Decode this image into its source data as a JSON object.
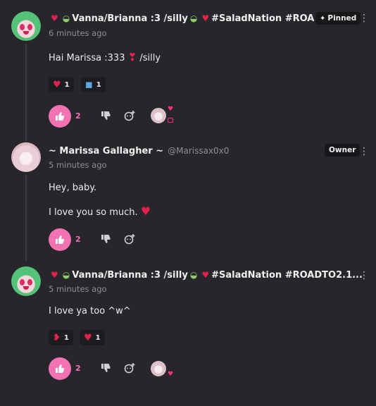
{
  "comments": [
    {
      "author": "Vanna/Brianna :3 /silly",
      "author_tags": "#SaladNation #ROA...",
      "timestamp": "6 minutes ago",
      "badge": "Pinned",
      "body": [
        "Hai Marissa :333",
        "/silly"
      ],
      "reactions": [
        {
          "emoji": "heart-emoji",
          "glyph": "♥",
          "count": "1"
        },
        {
          "emoji": "people-hugging-emoji",
          "glyph": "👥",
          "count": "1"
        }
      ],
      "likes": "2"
    },
    {
      "author": "~ Marissa Gallagher ~",
      "handle": "@Marissax0x0",
      "timestamp": "5 minutes ago",
      "badge": "Owner",
      "body": [
        "Hey, baby.",
        "I love you so much."
      ],
      "likes": "2"
    },
    {
      "author": "Vanna/Brianna :3 /silly",
      "author_tags": "#SaladNation #ROADTO2.1...",
      "timestamp": "5 minutes ago",
      "body": [
        "I love ya too ^w^"
      ],
      "reactions": [
        {
          "emoji": "kiss-mark-emoji",
          "glyph": "💋",
          "count": "1"
        },
        {
          "emoji": "heart-emoji",
          "glyph": "♥",
          "count": "1"
        }
      ],
      "likes": "2"
    }
  ],
  "colors": {
    "background": "#26262b",
    "like_accent": "#f272b4",
    "heart": "#e0224c",
    "badge_bg": "#17171a"
  },
  "icons": {
    "pin": "pin-icon",
    "like": "thumbs-up-icon",
    "dislike": "thumbs-down-icon",
    "reply": "reply-icon",
    "more": "more-vertical-icon"
  }
}
